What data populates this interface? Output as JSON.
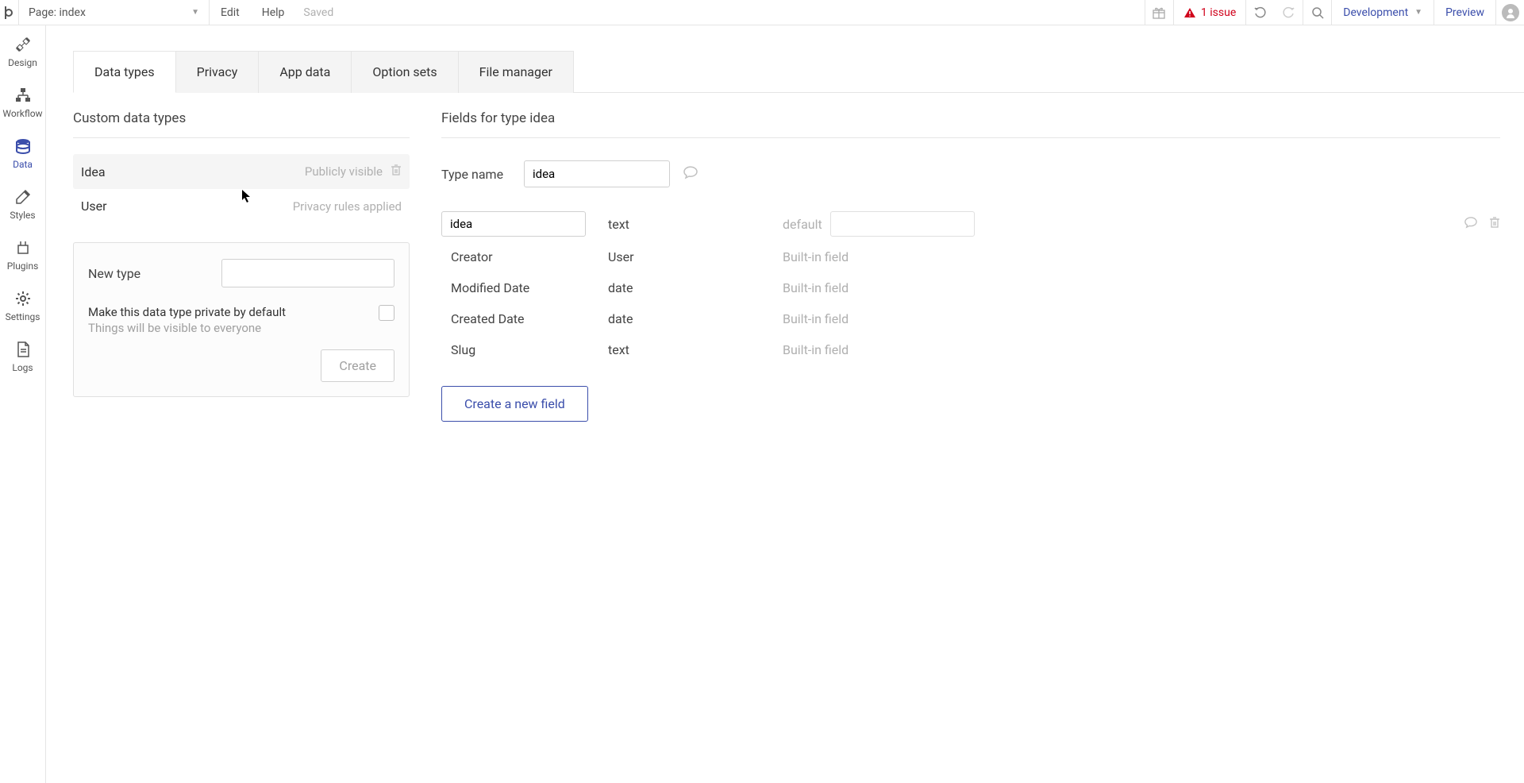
{
  "topbar": {
    "page_label": "Page: index",
    "edit": "Edit",
    "help": "Help",
    "saved": "Saved",
    "issue_text": "1 issue",
    "environment": "Development",
    "preview": "Preview"
  },
  "sidebar": {
    "items": [
      {
        "label": "Design"
      },
      {
        "label": "Workflow"
      },
      {
        "label": "Data"
      },
      {
        "label": "Styles"
      },
      {
        "label": "Plugins"
      },
      {
        "label": "Settings"
      },
      {
        "label": "Logs"
      }
    ]
  },
  "tabs": [
    {
      "label": "Data types"
    },
    {
      "label": "Privacy"
    },
    {
      "label": "App data"
    },
    {
      "label": "Option sets"
    },
    {
      "label": "File manager"
    }
  ],
  "left": {
    "title": "Custom data types",
    "types": [
      {
        "name": "Idea",
        "status": "Publicly visible",
        "selected": true,
        "deletable": true
      },
      {
        "name": "User",
        "status": "Privacy rules applied",
        "selected": false,
        "deletable": false
      }
    ],
    "new_type": {
      "label": "New type",
      "value": "",
      "private_label": "Make this data type private by default",
      "private_sub": "Things will be visible to everyone",
      "create": "Create"
    }
  },
  "right": {
    "title": "Fields for type idea",
    "typename_label": "Type name",
    "typename_value": "idea",
    "fields": {
      "custom": {
        "name": "idea",
        "type": "text",
        "default_label": "default",
        "default_value": ""
      },
      "builtin": [
        {
          "name": "Creator",
          "type": "User",
          "note": "Built-in field"
        },
        {
          "name": "Modified Date",
          "type": "date",
          "note": "Built-in field"
        },
        {
          "name": "Created Date",
          "type": "date",
          "note": "Built-in field"
        },
        {
          "name": "Slug",
          "type": "text",
          "note": "Built-in field"
        }
      ]
    },
    "new_field_btn": "Create a new field"
  }
}
